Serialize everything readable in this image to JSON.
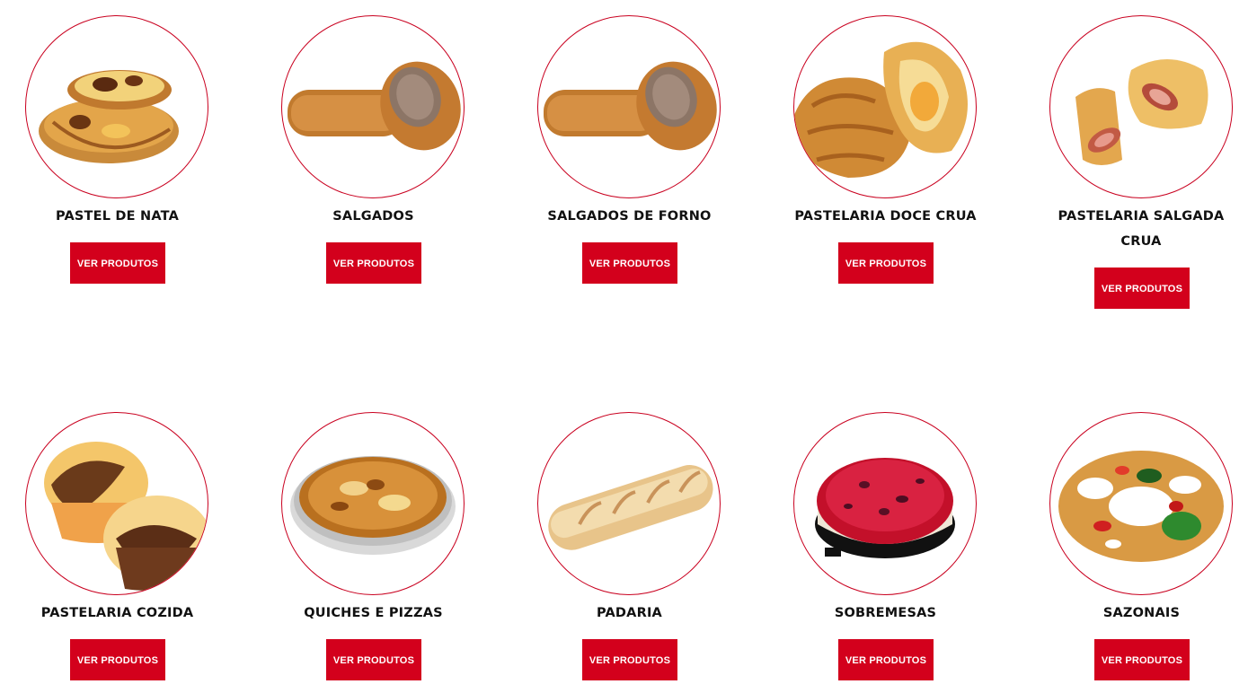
{
  "categories": [
    {
      "title": "PASTEL DE NATA",
      "button": "VER PRODUTOS"
    },
    {
      "title": "SALGADOS",
      "button": "VER PRODUTOS"
    },
    {
      "title": "SALGADOS DE FORNO",
      "button": "VER PRODUTOS"
    },
    {
      "title": "PASTELARIA DOCE CRUA",
      "button": "VER PRODUTOS"
    },
    {
      "title": "PASTELARIA SALGADA CRUA",
      "button": "VER PRODUTOS"
    },
    {
      "title": "PASTELARIA COZIDA",
      "button": "VER PRODUTOS"
    },
    {
      "title": "QUICHES E PIZZAS",
      "button": "VER PRODUTOS"
    },
    {
      "title": "PADARIA",
      "button": "VER PRODUTOS"
    },
    {
      "title": "SOBREMESAS",
      "button": "VER PRODUTOS"
    },
    {
      "title": "SAZONAIS",
      "button": "VER PRODUTOS"
    }
  ],
  "colors": {
    "accent": "#d3001c",
    "circle_border": "#c9001f",
    "title_text": "#111111",
    "button_text": "#ffffff"
  }
}
